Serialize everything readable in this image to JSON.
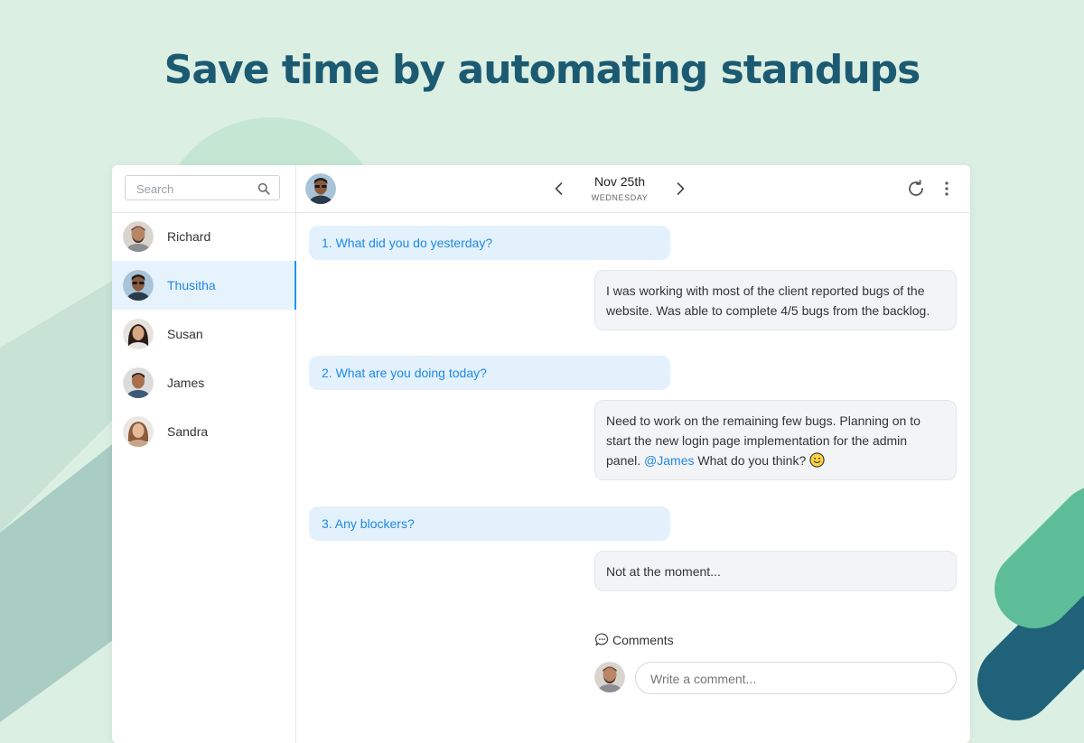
{
  "headline": "Save time by automating standups",
  "colors": {
    "accent": "#1e88e5",
    "headline": "#1c5a72",
    "background": "#dcefe3",
    "question_bg": "#e3f1fd",
    "answer_bg": "#f3f4f6"
  },
  "sidebar": {
    "search_placeholder": "Search",
    "search_icon": "search-icon",
    "users": [
      {
        "name": "Richard",
        "active": false
      },
      {
        "name": "Thusitha",
        "active": true
      },
      {
        "name": "Susan",
        "active": false
      },
      {
        "name": "James",
        "active": false
      },
      {
        "name": "Sandra",
        "active": false
      }
    ]
  },
  "topbar": {
    "date": "Nov 25th",
    "weekday": "WEDNESDAY",
    "prev_icon": "chevron-left-icon",
    "next_icon": "chevron-right-icon",
    "refresh_icon": "refresh-icon",
    "more_icon": "more-vertical-icon"
  },
  "standup": [
    {
      "question": "1. What did you do yesterday?",
      "answer": "I was working with most of the client reported bugs of the website. Was able to complete 4/5 bugs from the backlog."
    },
    {
      "question": "2. What are you doing today?",
      "answer_pre": "Need to work on the remaining few bugs. Planning on to start the new login page implementation for the admin panel.",
      "mention": "@James",
      "answer_post": "What do you think?",
      "emoji": "slightly-smiling-face"
    },
    {
      "question": "3. Any blockers?",
      "answer": "Not at the moment..."
    }
  ],
  "comments": {
    "label": "Comments",
    "placeholder": "Write a comment..."
  }
}
